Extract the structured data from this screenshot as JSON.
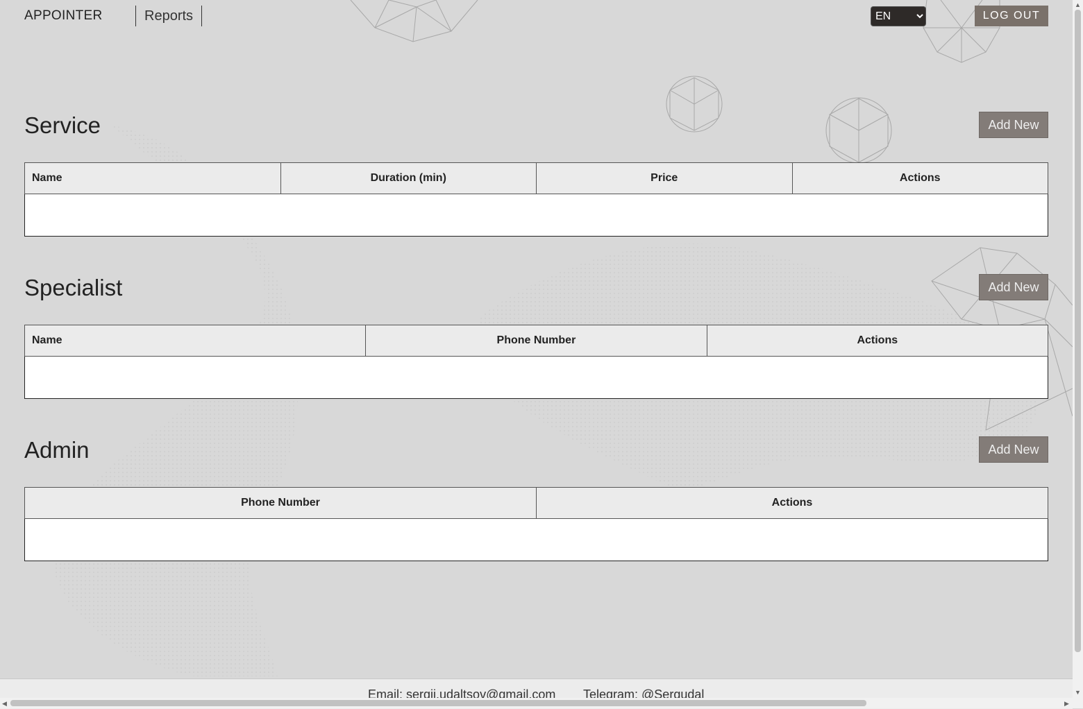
{
  "header": {
    "brand": "APPOINTER",
    "nav_reports": "Reports",
    "language": {
      "selected": "EN",
      "options": [
        "EN"
      ]
    },
    "logout_label": "LOG OUT"
  },
  "sections": {
    "service": {
      "title": "Service",
      "add_label": "Add New",
      "columns": [
        "Name",
        "Duration (min)",
        "Price",
        "Actions"
      ]
    },
    "specialist": {
      "title": "Specialist",
      "add_label": "Add New",
      "columns": [
        "Name",
        "Phone Number",
        "Actions"
      ]
    },
    "admin": {
      "title": "Admin",
      "add_label": "Add New",
      "columns": [
        "Phone Number",
        "Actions"
      ]
    }
  },
  "footer": {
    "email": "Email: sergii.udaltsov@gmail.com",
    "telegram": "Telegram: @Sergudal"
  },
  "colors": {
    "page_bg": "#d8d8d8",
    "header_th_bg": "#ebebeb",
    "add_button_bg": "#837c78",
    "logout_bg": "#7a716a",
    "select_bg": "#2e2a28"
  },
  "icons": {
    "scroll_up": "scroll-up-arrow-icon",
    "scroll_down": "scroll-down-arrow-icon",
    "scroll_left": "scroll-left-arrow-icon",
    "scroll_right": "scroll-right-arrow-icon"
  }
}
